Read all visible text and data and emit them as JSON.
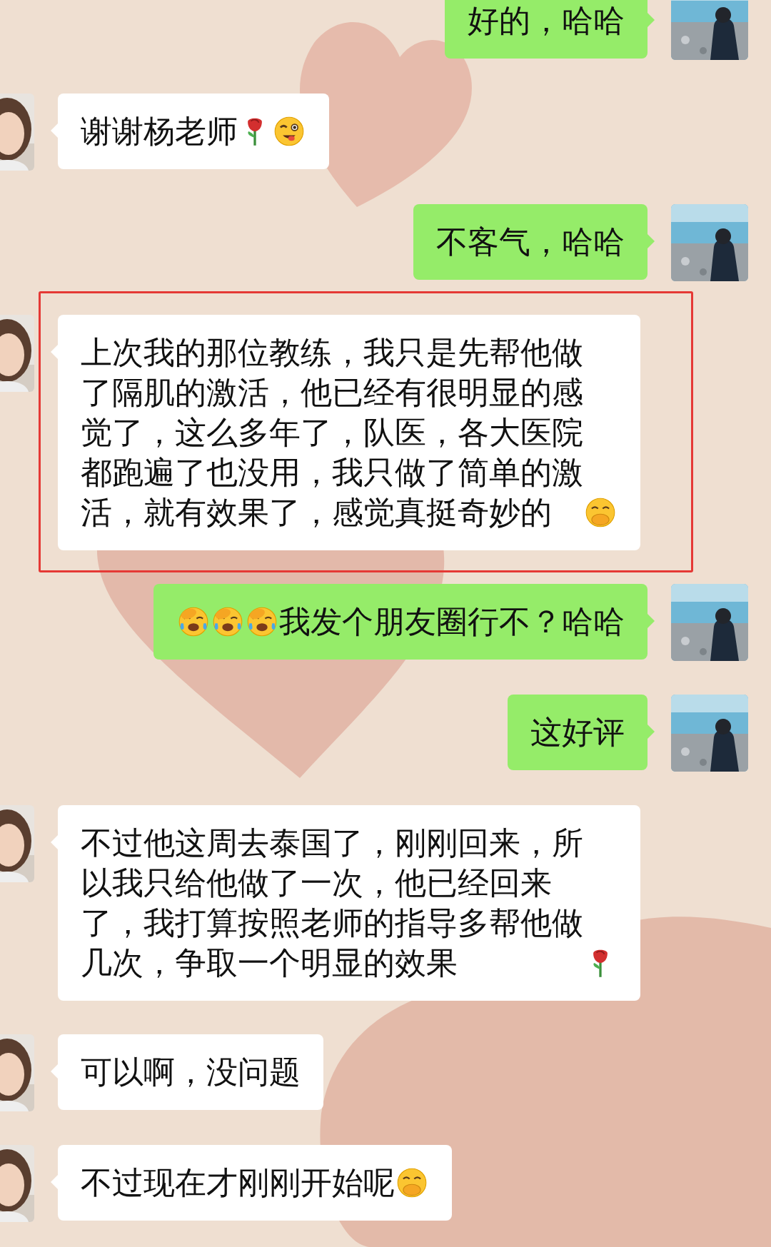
{
  "messages": [
    {
      "kind": "sent",
      "highlighted": false,
      "parts": [
        {
          "kind": "text",
          "text": "好的，哈哈"
        }
      ]
    },
    {
      "kind": "received",
      "highlighted": false,
      "parts": [
        {
          "kind": "text",
          "text": "谢谢杨老师"
        },
        {
          "kind": "rose"
        },
        {
          "kind": "wink"
        }
      ]
    },
    {
      "kind": "sent",
      "highlighted": false,
      "parts": [
        {
          "kind": "text",
          "text": "不客气，哈哈"
        }
      ]
    },
    {
      "kind": "received",
      "highlighted": true,
      "parts": [
        {
          "kind": "text",
          "text": "上次我的那位教练，我只是先帮他做了隔肌的激活，他已经有很明显的感觉了，这么多年了，队医，各大医院都跑遍了也没用，我只做了简单的激活，就有效果了，感觉真挺奇妙的"
        },
        {
          "kind": "giggle"
        }
      ]
    },
    {
      "kind": "sent",
      "highlighted": false,
      "parts": [
        {
          "kind": "facepalm"
        },
        {
          "kind": "facepalm"
        },
        {
          "kind": "facepalm"
        },
        {
          "kind": "text",
          "text": "我发个朋友圈行不？哈哈"
        }
      ]
    },
    {
      "kind": "sent",
      "highlighted": false,
      "parts": [
        {
          "kind": "text",
          "text": "这好评"
        }
      ]
    },
    {
      "kind": "received",
      "highlighted": false,
      "parts": [
        {
          "kind": "text",
          "text": "不过他这周去泰国了，刚刚回来，所以我只给他做了一次，他已经回来了，我打算按照老师的指导多帮他做几次，争取一个明显的效果"
        },
        {
          "kind": "rose"
        }
      ]
    },
    {
      "kind": "received",
      "highlighted": false,
      "parts": [
        {
          "kind": "text",
          "text": "可以啊，没问题"
        }
      ]
    },
    {
      "kind": "received",
      "highlighted": false,
      "parts": [
        {
          "kind": "text",
          "text": "不过现在才刚刚开始呢"
        },
        {
          "kind": "giggle"
        }
      ]
    }
  ]
}
